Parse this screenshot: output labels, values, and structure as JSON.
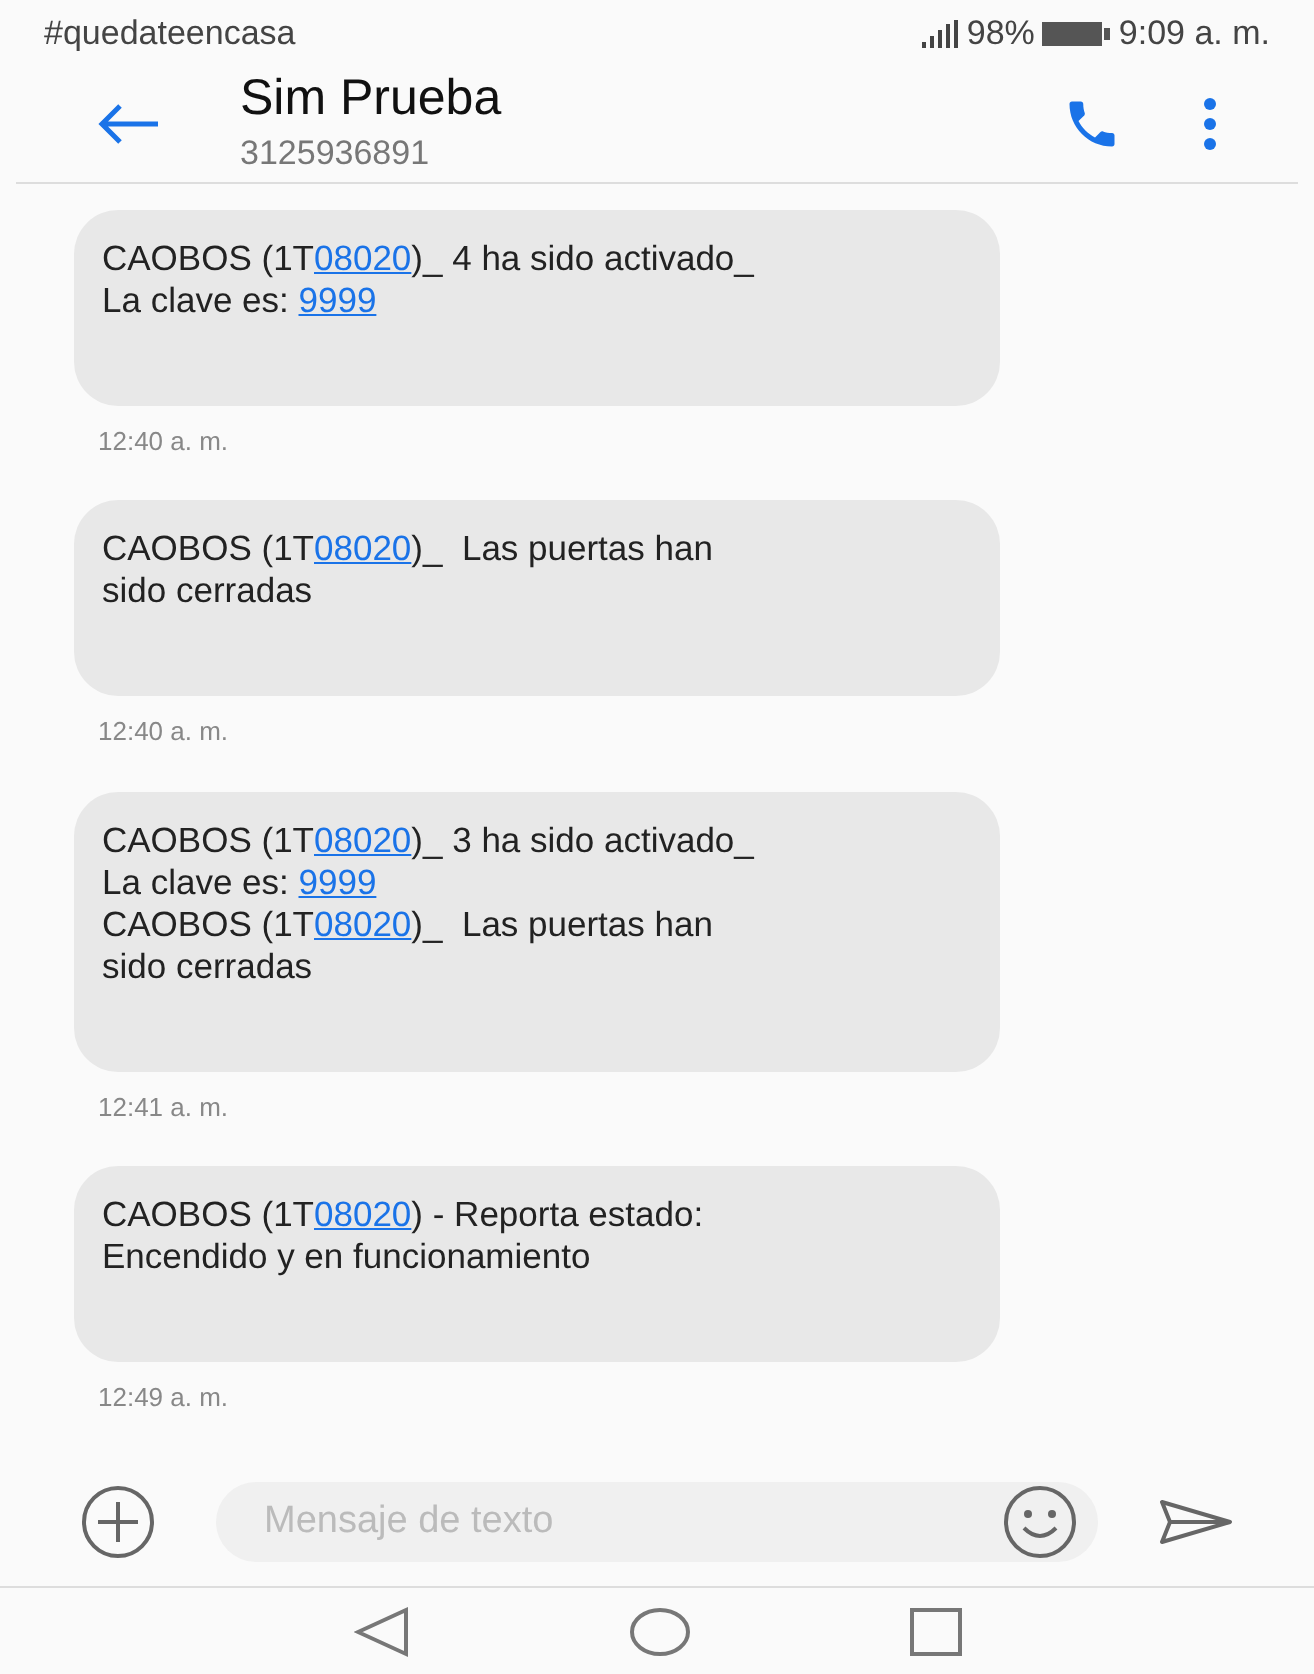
{
  "status_bar": {
    "left_text": "#quedateencasa",
    "battery": "98%",
    "time": "9:09 a. m."
  },
  "header": {
    "name": "Sim Prueba",
    "number": "3125936891"
  },
  "messages": [
    {
      "lines": [
        [
          {
            "text": "CAOBOS (1T",
            "link": false
          },
          {
            "text": "08020",
            "link": true
          },
          {
            "text": ")_ 4 ha sido activado_",
            "link": false
          }
        ],
        [
          {
            "text": "La clave es: ",
            "link": false
          },
          {
            "text": "9999",
            "link": true
          }
        ]
      ],
      "time": "12:40 a. m."
    },
    {
      "lines": [
        [
          {
            "text": "CAOBOS (1T",
            "link": false
          },
          {
            "text": "08020",
            "link": true
          },
          {
            "text": ")_  Las puertas han",
            "link": false
          }
        ],
        [
          {
            "text": "sido cerradas",
            "link": false
          }
        ]
      ],
      "time": "12:40 a. m."
    },
    {
      "lines": [
        [
          {
            "text": "CAOBOS (1T",
            "link": false
          },
          {
            "text": "08020",
            "link": true
          },
          {
            "text": ")_ 3 ha sido activado_",
            "link": false
          }
        ],
        [
          {
            "text": "La clave es: ",
            "link": false
          },
          {
            "text": "9999",
            "link": true
          }
        ],
        [
          {
            "text": "CAOBOS (1T",
            "link": false
          },
          {
            "text": "08020",
            "link": true
          },
          {
            "text": ")_  Las puertas han",
            "link": false
          }
        ],
        [
          {
            "text": "sido cerradas",
            "link": false
          }
        ]
      ],
      "time": "12:41 a. m."
    },
    {
      "lines": [
        [
          {
            "text": "CAOBOS (1T",
            "link": false
          },
          {
            "text": "08020",
            "link": true
          },
          {
            "text": ") - Reporta estado:",
            "link": false
          }
        ],
        [
          {
            "text": "Encendido y en funcionamiento",
            "link": false
          }
        ]
      ],
      "time": "12:49 a. m."
    }
  ],
  "composer": {
    "placeholder": "Mensaje de texto"
  }
}
